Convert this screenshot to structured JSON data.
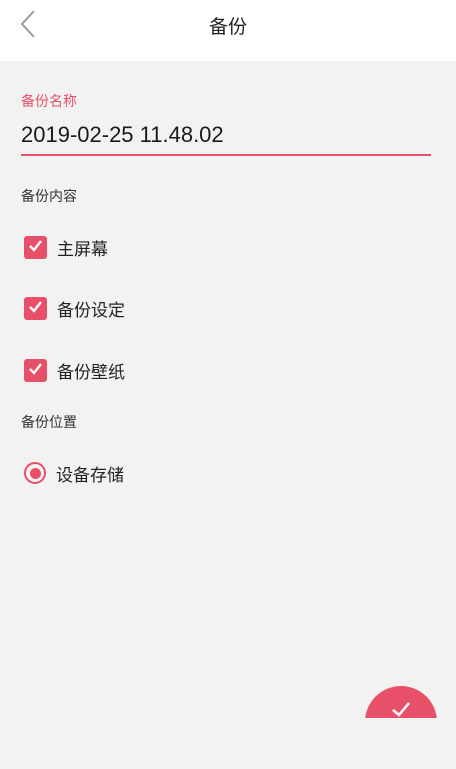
{
  "header": {
    "title": "备份",
    "back_icon": "chevron-left-icon"
  },
  "form": {
    "name_label": "备份名称",
    "name_value": "2019-02-25 11.48.02",
    "content_label": "备份内容",
    "content_options": [
      {
        "label": "主屏幕",
        "checked": true
      },
      {
        "label": "备份设定",
        "checked": true
      },
      {
        "label": "备份壁纸",
        "checked": true
      }
    ],
    "location_label": "备份位置",
    "location_options": [
      {
        "label": "设备存储",
        "selected": true
      }
    ]
  },
  "fab": {
    "icon": "checkmark-icon"
  },
  "colors": {
    "accent": "#e8506a",
    "background": "#f2f2f2",
    "header_bg": "#ffffff"
  }
}
